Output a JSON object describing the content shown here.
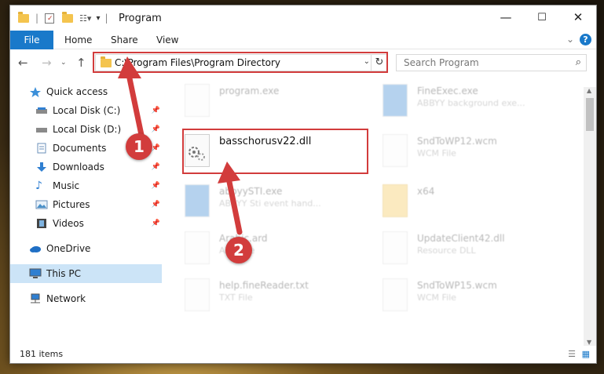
{
  "window": {
    "title": "Program",
    "controls": {
      "minimize": "—",
      "maximize": "☐",
      "close": "✕"
    }
  },
  "ribbon": {
    "file": "File",
    "tabs": [
      "Home",
      "Share",
      "View"
    ],
    "help": "?"
  },
  "nav": {
    "address": "C:\\Program Files\\Program Directory",
    "search_placeholder": "Search Program"
  },
  "sidebar": {
    "items": [
      {
        "label": "Quick access",
        "icon": "star-icon",
        "pinned": false
      },
      {
        "label": "Local Disk (C:)",
        "icon": "drive-icon",
        "pinned": true
      },
      {
        "label": "Local Disk (D:)",
        "icon": "drive-icon",
        "pinned": true
      },
      {
        "label": "Documents",
        "icon": "documents-icon",
        "pinned": true
      },
      {
        "label": "Downloads",
        "icon": "download-icon",
        "pinned": true
      },
      {
        "label": "Music",
        "icon": "music-icon",
        "pinned": true
      },
      {
        "label": "Pictures",
        "icon": "pictures-icon",
        "pinned": true
      },
      {
        "label": "Videos",
        "icon": "videos-icon",
        "pinned": true
      },
      {
        "label": "OneDrive",
        "icon": "cloud-icon",
        "pinned": false
      },
      {
        "label": "This PC",
        "icon": "computer-icon",
        "pinned": false,
        "selected": true
      },
      {
        "label": "Network",
        "icon": "network-icon",
        "pinned": false
      }
    ]
  },
  "files": {
    "left": [
      {
        "name": "program.exe",
        "sub": ""
      },
      {
        "name": "basschorusv22.dll",
        "sub": ""
      },
      {
        "name": "abbyySTI.exe",
        "sub": "ABBYY Sti event hand..."
      },
      {
        "name": "Arabic.ard",
        "sub": "ARD File"
      },
      {
        "name": "help.fineReader.txt",
        "sub": "TXT File"
      }
    ],
    "right": [
      {
        "name": "FineExec.exe",
        "sub": "ABBYY background exe..."
      },
      {
        "name": "SndToWP12.wcm",
        "sub": "WCM File"
      },
      {
        "name": "x64",
        "sub": ""
      },
      {
        "name": "UpdateClient42.dll",
        "sub": "Resource DLL"
      },
      {
        "name": "SndToWP15.wcm",
        "sub": "WCM File"
      }
    ]
  },
  "status": {
    "items": "181 items"
  },
  "markers": [
    "1",
    "2"
  ],
  "colors": {
    "accent": "#1979ca",
    "highlight": "#d23c3c",
    "selected": "#cce4f7"
  }
}
